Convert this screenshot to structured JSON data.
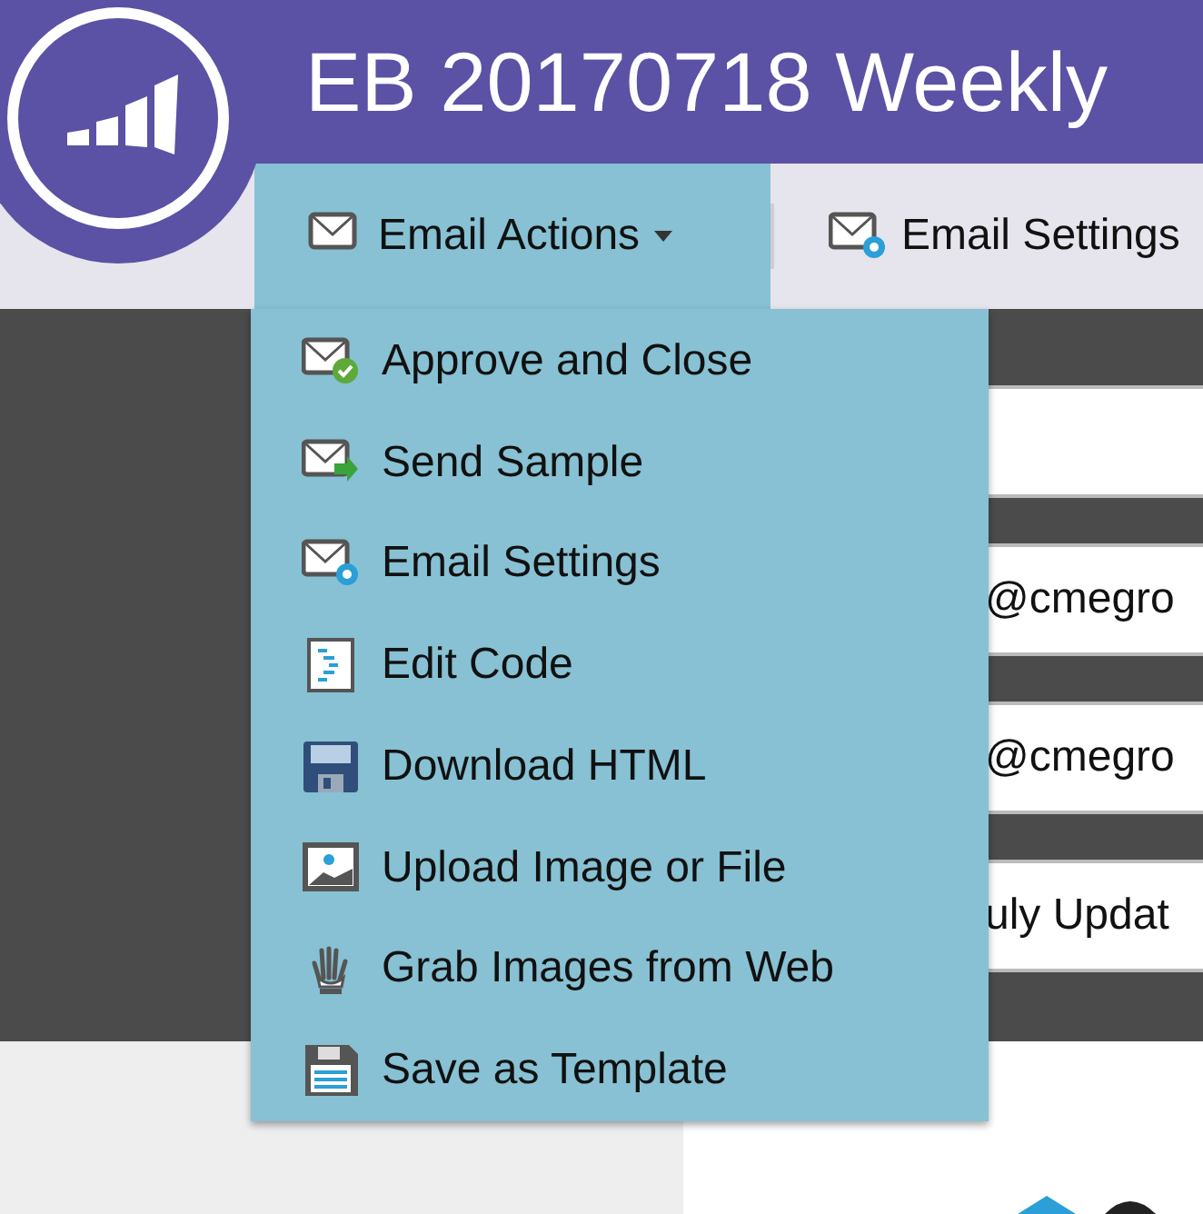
{
  "header": {
    "title": "EB 20170718 Weekly"
  },
  "toolbar": {
    "tabs": [
      {
        "label": "Email Actions",
        "selected": true,
        "kind": "dropdown"
      },
      {
        "label": "Email Settings",
        "selected": false,
        "kind": "settings"
      }
    ]
  },
  "menu": {
    "items": [
      {
        "label": "Approve and Close",
        "kind": "approve"
      },
      {
        "label": "Send Sample",
        "kind": "send"
      },
      {
        "label": "Email Settings",
        "kind": "settings"
      },
      {
        "label": "Edit Code",
        "kind": "code"
      },
      {
        "label": "Download HTML",
        "kind": "download"
      },
      {
        "label": "Upload Image or File",
        "kind": "upload"
      },
      {
        "label": "Grab Images from Web",
        "kind": "grab"
      },
      {
        "label": "Save as Template",
        "kind": "template"
      }
    ]
  },
  "fields": [
    {
      "value": "@cmegro"
    },
    {
      "value": "@cmegro"
    },
    {
      "value": "uly Updat"
    }
  ]
}
